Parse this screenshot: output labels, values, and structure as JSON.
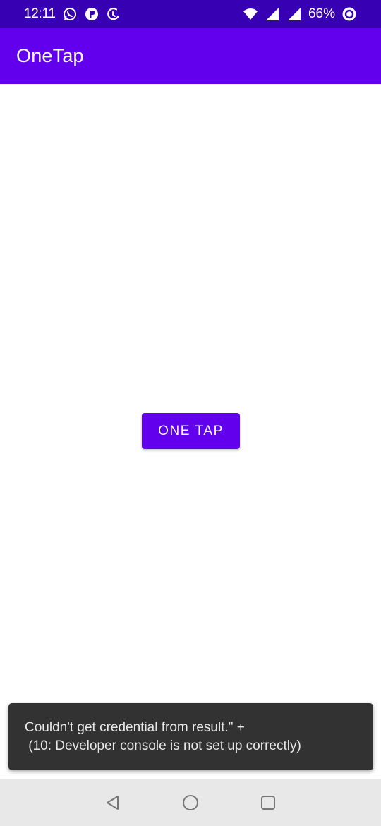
{
  "status_bar": {
    "time": "12:11",
    "battery_percent": "66%",
    "left_icons": [
      "whatsapp-icon",
      "app-notification-icon",
      "do-not-disturb-icon"
    ],
    "right_icons": [
      "wifi-icon",
      "signal-icon",
      "signal-icon",
      "battery-saver-icon"
    ]
  },
  "app_bar": {
    "title": "OneTap"
  },
  "main": {
    "button_label": "ONE TAP"
  },
  "snackbar": {
    "line1": "Couldn't get credential from result.\" +",
    "line2": " (10: Developer console is not set up correctly)"
  },
  "nav_bar": {
    "buttons": [
      "back-icon",
      "home-icon",
      "recents-icon"
    ]
  },
  "colors": {
    "status_bar": "#3700b3",
    "primary": "#6200ee",
    "snackbar_bg": "#323232",
    "nav_bar_bg": "#e8e8e8"
  }
}
